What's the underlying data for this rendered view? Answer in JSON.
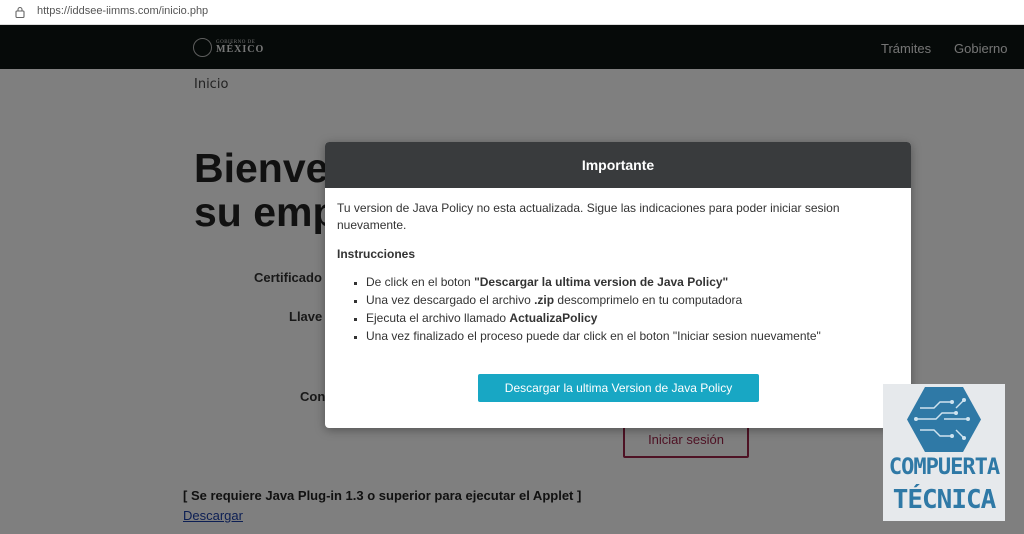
{
  "browser": {
    "url": "https://iddsee-iimms.com/inicio.php",
    "lock_icon": "lock-icon"
  },
  "header": {
    "logo": {
      "small": "GOBIERNO DE",
      "big": "MÉXICO"
    },
    "nav": [
      {
        "label": "Trámites"
      },
      {
        "label": "Gobierno"
      }
    ]
  },
  "breadcrumb": "Inicio",
  "page": {
    "welcome_line1": "Bienve",
    "welcome_line2": "su emp",
    "labels": {
      "certificado": "Certificado",
      "llave": "Llave",
      "contrasena": "Con"
    },
    "login_button": "Iniciar sesión",
    "java_requirement": "[ Se requiere Java Plug-in 1.3 o superior para ejecutar el Applet ]",
    "download_link": "Descargar"
  },
  "modal": {
    "title": "Importante",
    "message": "Tu version de Java Policy no esta actualizada. Sigue las indicaciones para poder iniciar sesion nuevamente.",
    "instructions_title": "Instrucciones",
    "steps": [
      {
        "pre": "De click en el boton ",
        "bold": "\"Descargar la ultima version de Java Policy\"",
        "post": ""
      },
      {
        "pre": "Una vez descargado el archivo ",
        "bold": ".zip",
        "post": " descomprimelo en tu computadora"
      },
      {
        "pre": "Ejecuta el archivo llamado ",
        "bold": "ActualizaPolicy",
        "post": ""
      },
      {
        "pre": "Una vez finalizado el proceso puede dar click en el boton \"Iniciar sesion nuevamente\"",
        "bold": "",
        "post": ""
      }
    ],
    "button": "Descargar la ultima Version de Java Policy"
  },
  "watermark": {
    "line1": "COMPUERTA",
    "line2": "TÉCNICA"
  },
  "colors": {
    "header_bg": "#0c1512",
    "modal_header": "#393b3d",
    "modal_button": "#18a7c4",
    "login_border": "#9d2449",
    "watermark": "#2f79a6"
  }
}
